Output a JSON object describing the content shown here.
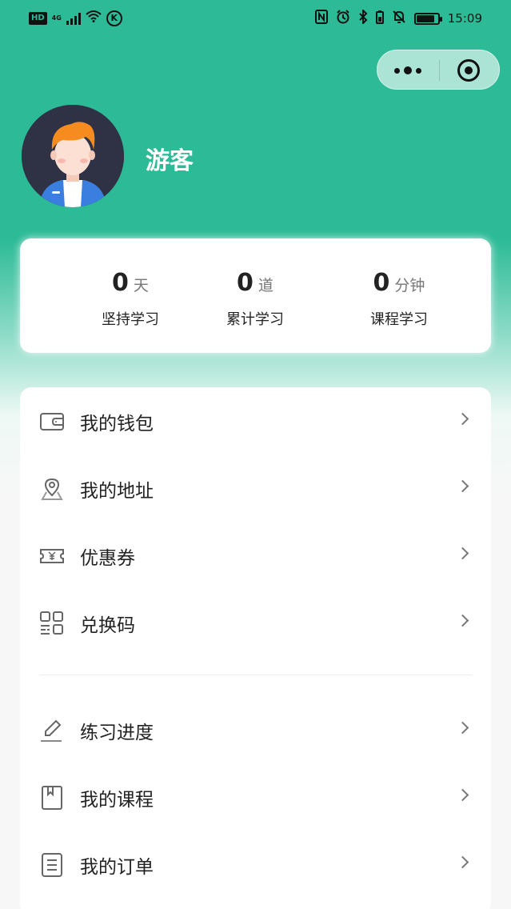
{
  "status_bar": {
    "hd": "HD",
    "network": "4G",
    "time": "15:09",
    "k": "K"
  },
  "profile": {
    "username": "游客"
  },
  "stats": [
    {
      "value": "0",
      "unit": "天",
      "label": "坚持学习"
    },
    {
      "value": "0",
      "unit": "道",
      "label": "累计学习"
    },
    {
      "value": "0",
      "unit": "分钟",
      "label": "课程学习"
    }
  ],
  "menu": {
    "group1": [
      {
        "label": "我的钱包",
        "icon": "wallet-icon"
      },
      {
        "label": "我的地址",
        "icon": "location-icon"
      },
      {
        "label": "优惠券",
        "icon": "coupon-icon"
      },
      {
        "label": "兑换码",
        "icon": "qr-code-icon"
      }
    ],
    "group2": [
      {
        "label": "练习进度",
        "icon": "pencil-icon"
      },
      {
        "label": "我的课程",
        "icon": "book-icon"
      },
      {
        "label": "我的订单",
        "icon": "order-icon"
      }
    ]
  },
  "colors": {
    "brand": "#2dbb97",
    "background": "#f7f7f7",
    "card": "#ffffff",
    "text": "#222222",
    "avatar_bg": "#2f3144"
  }
}
